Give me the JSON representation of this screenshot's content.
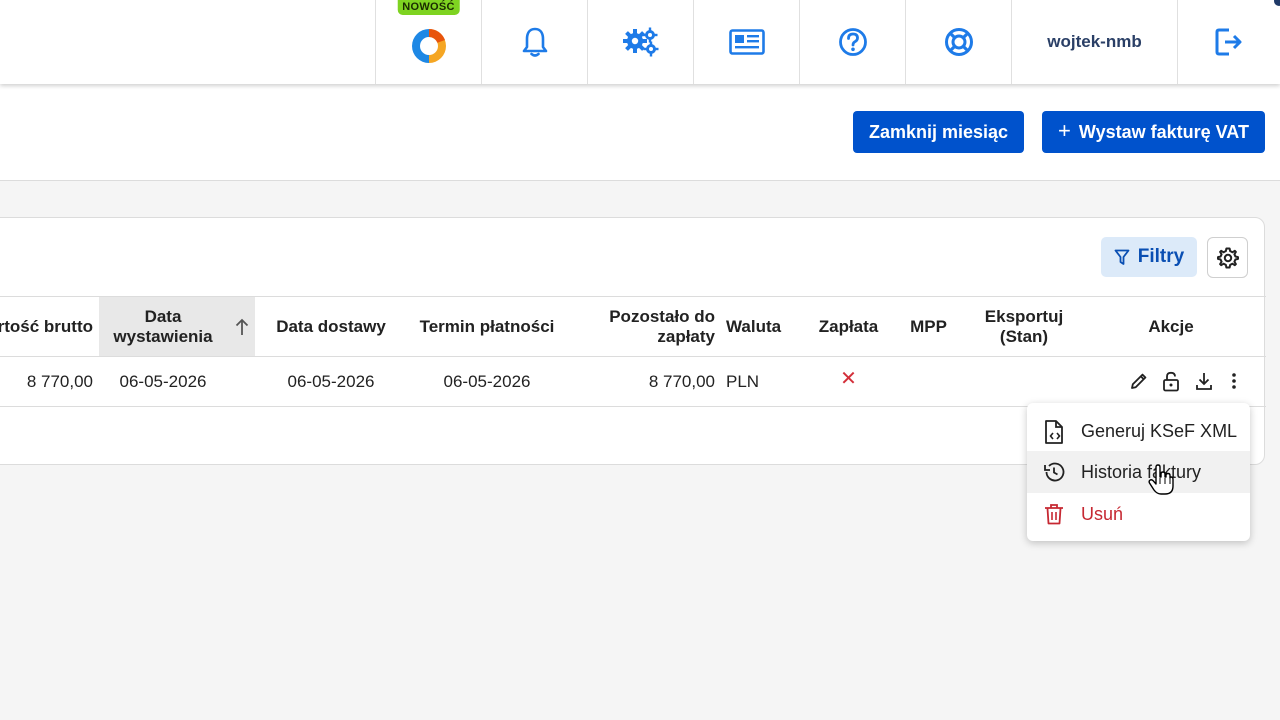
{
  "topbar": {
    "new_badge": "NOWOŚĆ",
    "icons": [
      "donut-chart-icon",
      "bell-icon",
      "gears-icon",
      "newspaper-icon",
      "help-icon",
      "lifebuoy-icon",
      "logout-icon"
    ],
    "username": "wojtek-nmb"
  },
  "actions": {
    "close_month": "Zamknij miesiąc",
    "plus": "+",
    "issue_invoice": "Wystaw fakturę VAT"
  },
  "table": {
    "filters_label": "Filtry",
    "headers": {
      "gross_value": "rtość brutto",
      "issue_date_line1": "Data",
      "issue_date_line2": "wystawienia",
      "delivery_date": "Data dostawy",
      "payment_term": "Termin płatności",
      "remaining_line1": "Pozostało do",
      "remaining_line2": "zapłaty",
      "currency": "Waluta",
      "paid": "Zapłata",
      "mpp": "MPP",
      "export_line1": "Eksportuj",
      "export_line2": "(Stan)",
      "actions": "Akcje"
    },
    "rows": [
      {
        "gross_value": "8 770,00",
        "issue_date": "06-05-2026",
        "delivery_date": "06-05-2026",
        "payment_term": "06-05-2026",
        "remaining": "8 770,00",
        "currency": "PLN",
        "paid": "✕",
        "mpp": "",
        "export": ""
      }
    ]
  },
  "menu": {
    "items": [
      {
        "label": "Generuj KSeF XML",
        "icon": "file-code-icon"
      },
      {
        "label": "Historia faktury",
        "icon": "history-icon"
      },
      {
        "label": "Usuń",
        "icon": "trash-icon"
      }
    ]
  },
  "colors": {
    "primary": "#0052cc",
    "danger": "#c62832",
    "badge_green": "#7ed321",
    "filters_bg": "#dceaf9"
  }
}
